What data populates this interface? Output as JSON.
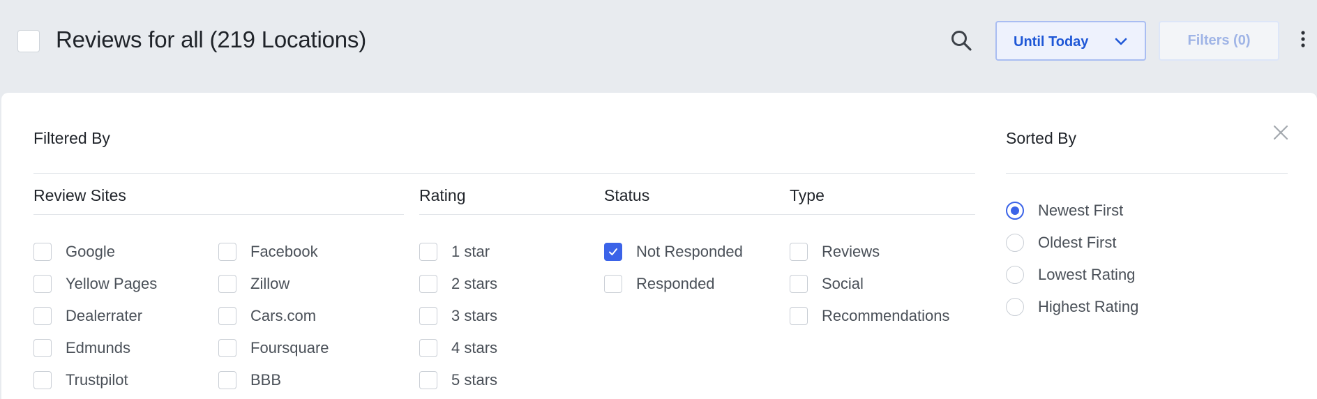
{
  "header": {
    "title": "Reviews for all (219 Locations)",
    "date_filter": "Until Today",
    "filters_button": "Filters (0)"
  },
  "panel": {
    "filtered_by": "Filtered By",
    "sorted_by": "Sorted By",
    "columns": {
      "review_sites": "Review Sites",
      "rating": "Rating",
      "status": "Status",
      "type": "Type"
    },
    "review_sites": [
      {
        "label": "Google",
        "checked": false
      },
      {
        "label": "Facebook",
        "checked": false
      },
      {
        "label": "Yellow Pages",
        "checked": false
      },
      {
        "label": "Zillow",
        "checked": false
      },
      {
        "label": "Dealerrater",
        "checked": false
      },
      {
        "label": "Cars.com",
        "checked": false
      },
      {
        "label": "Edmunds",
        "checked": false
      },
      {
        "label": "Foursquare",
        "checked": false
      },
      {
        "label": "Trustpilot",
        "checked": false
      },
      {
        "label": "BBB",
        "checked": false
      }
    ],
    "ratings": [
      {
        "label": "1 star",
        "checked": false
      },
      {
        "label": "2 stars",
        "checked": false
      },
      {
        "label": "3 stars",
        "checked": false
      },
      {
        "label": "4 stars",
        "checked": false
      },
      {
        "label": "5 stars",
        "checked": false
      }
    ],
    "statuses": [
      {
        "label": "Not Responded",
        "checked": true
      },
      {
        "label": "Responded",
        "checked": false
      }
    ],
    "types": [
      {
        "label": "Reviews",
        "checked": false
      },
      {
        "label": "Social",
        "checked": false
      },
      {
        "label": "Recommendations",
        "checked": false
      }
    ],
    "sort_options": [
      {
        "label": "Newest First",
        "selected": true
      },
      {
        "label": "Oldest First",
        "selected": false
      },
      {
        "label": "Lowest Rating",
        "selected": false
      },
      {
        "label": "Highest Rating",
        "selected": false
      }
    ]
  },
  "icons": {
    "search": "search-icon",
    "chevron": "chevron-down-icon",
    "kebab": "more-vertical-icon",
    "close": "close-icon",
    "check": "check-icon"
  },
  "colors": {
    "accent": "#3b63e8",
    "accent_text": "#1e57d6",
    "header_bg": "#e8ebef",
    "filters_disabled_text": "#9fb4e6"
  }
}
